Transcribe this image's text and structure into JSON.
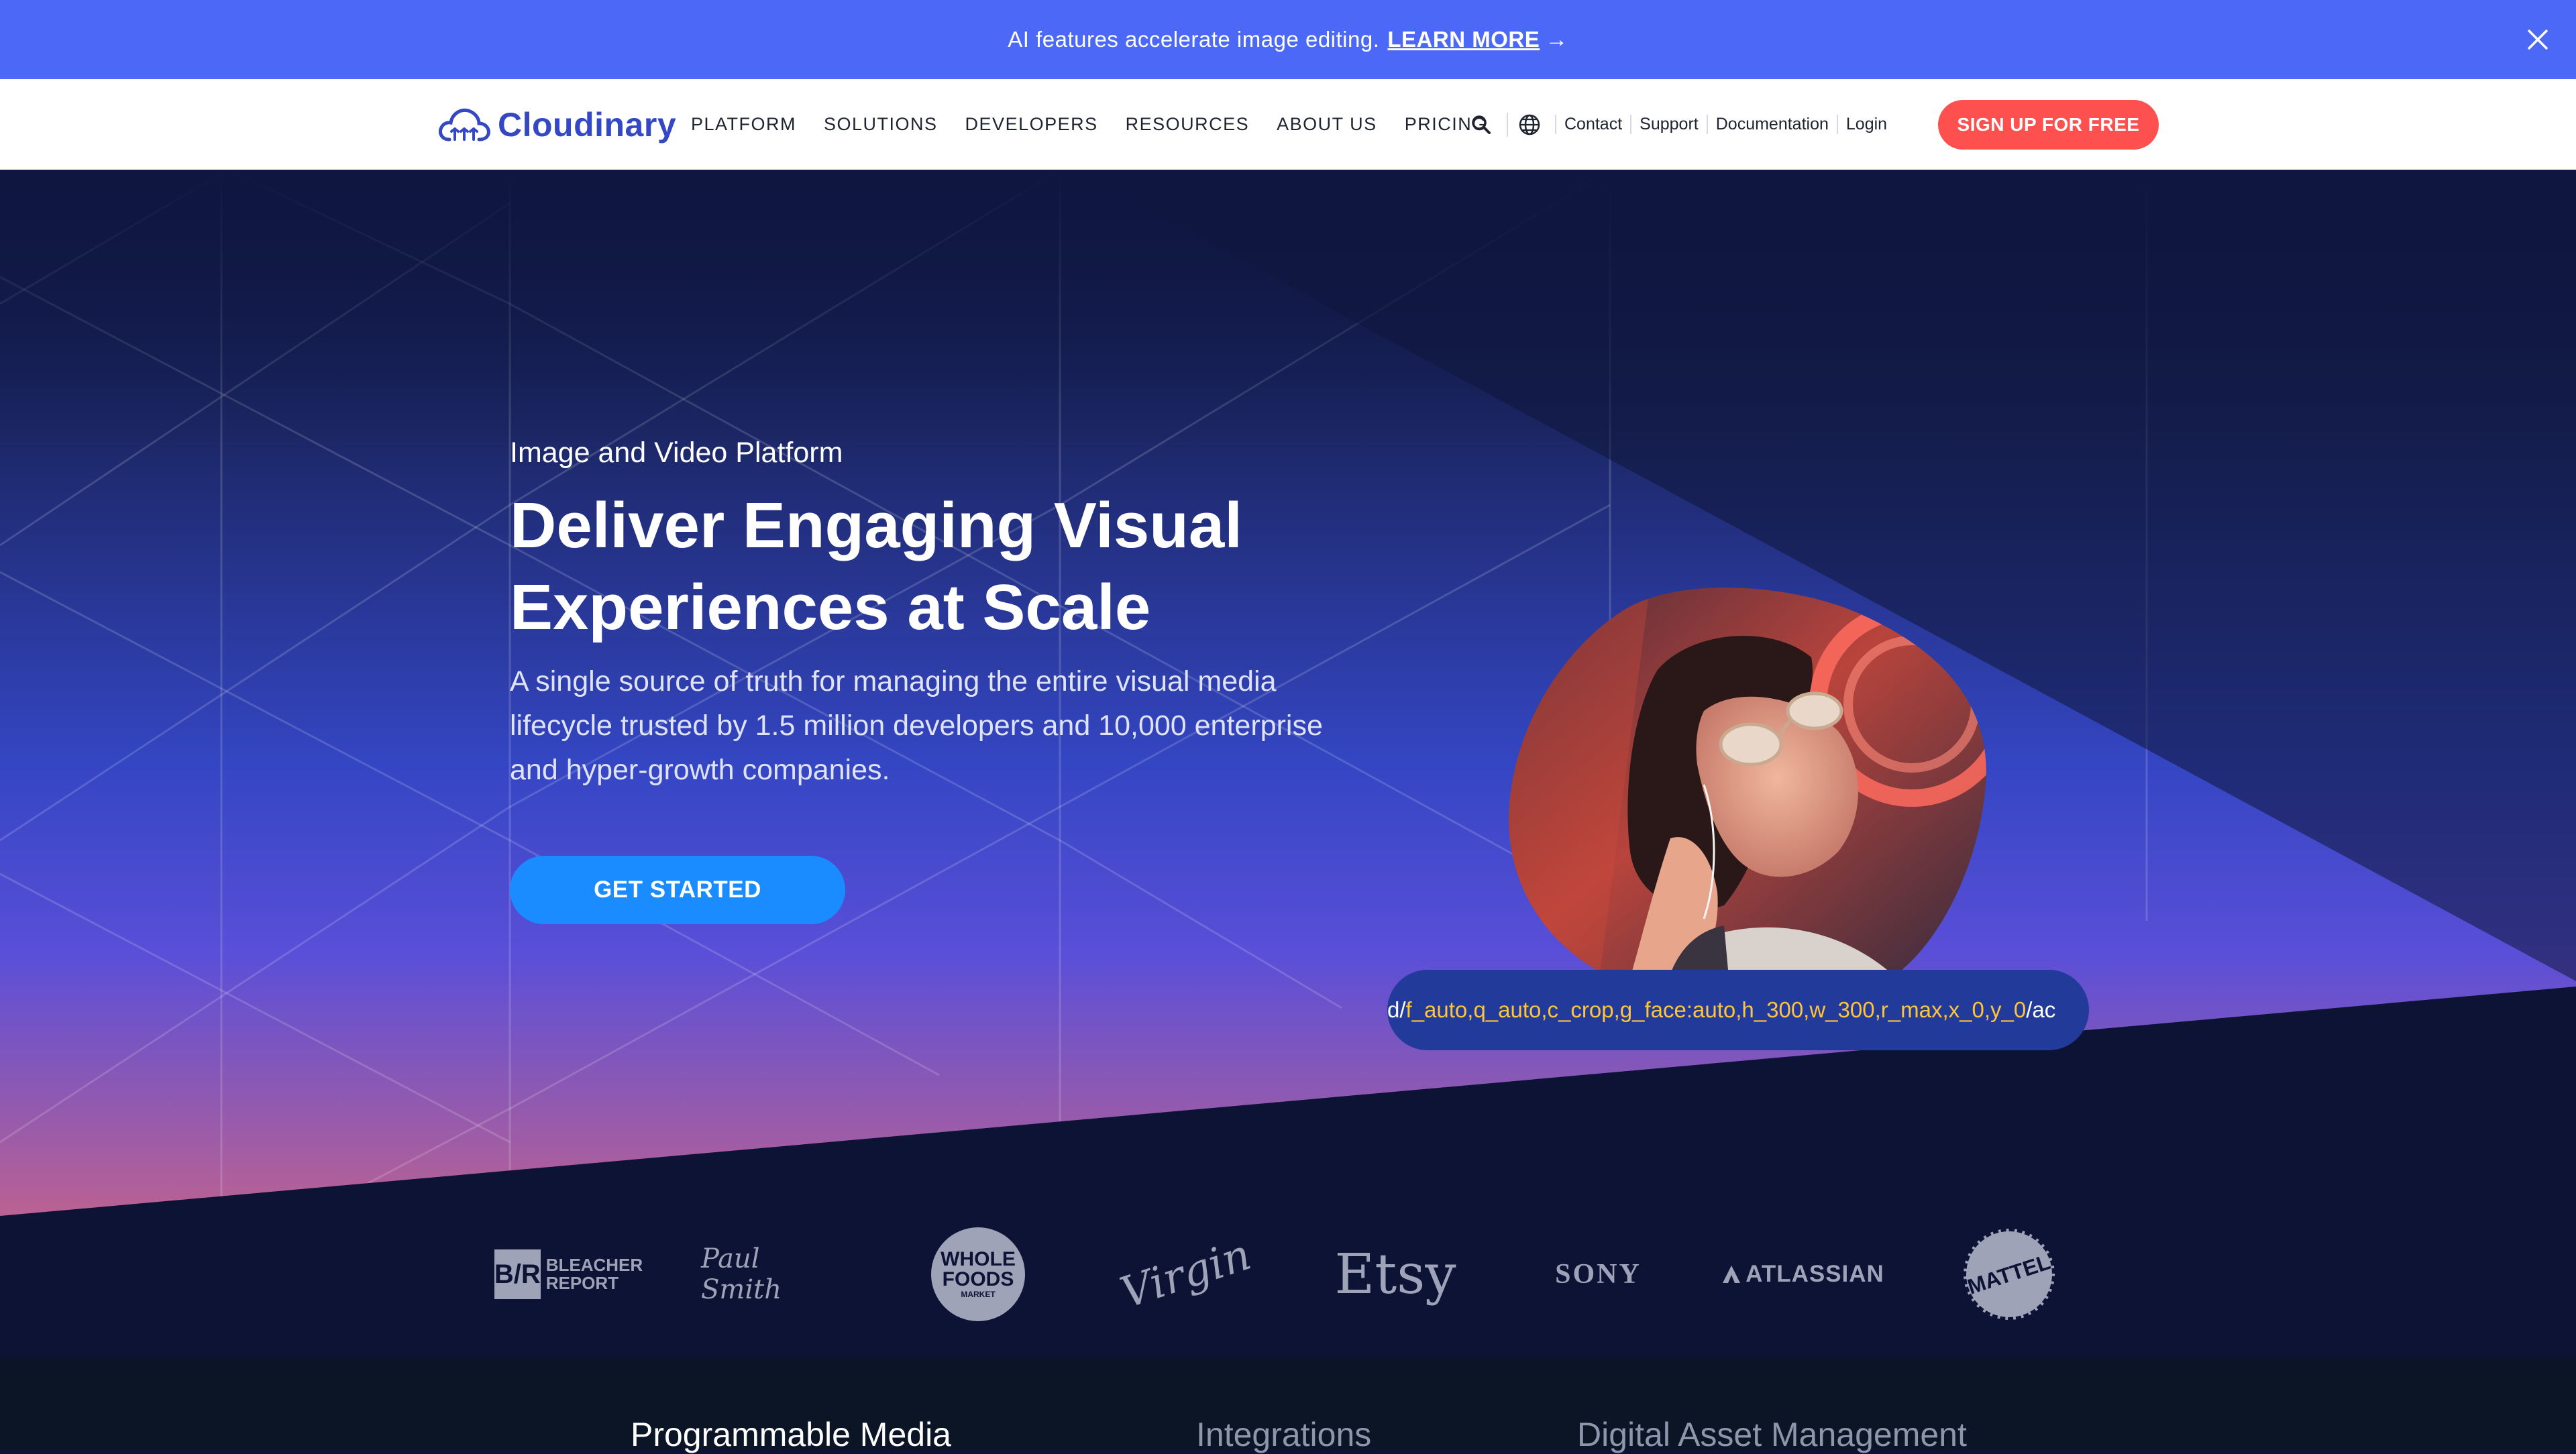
{
  "announcement": {
    "text": "AI features accelerate image editing.",
    "link_label": "LEARN MORE",
    "arrow": "→",
    "close_icon": "close-icon"
  },
  "nav": {
    "logo_text": "Cloudinary",
    "menu": [
      "PLATFORM",
      "SOLUTIONS",
      "DEVELOPERS",
      "RESOURCES",
      "ABOUT US",
      "PRICING"
    ],
    "icons": [
      "search-icon",
      "globe-icon"
    ],
    "utility_links": [
      "Contact",
      "Support",
      "Documentation",
      "Login"
    ],
    "signup_label": "SIGN UP FOR FREE"
  },
  "hero": {
    "eyebrow": "Image and Video Platform",
    "headline_line1": "Deliver Engaging Visual",
    "headline_line2": "Experiences at Scale",
    "subtext": "A single source of truth for managing the entire visual media lifecycle trusted by 1.5 million developers and 10,000 enterprise and hyper-growth companies.",
    "cta_label": "GET STARTED",
    "url_prefix": "d/",
    "url_params": "f_auto,q_auto,c_crop,g_face:auto,h_300,w_300,r_max,x_0,y_0",
    "url_suffix": "/ac"
  },
  "logos": {
    "bleacher_mark": "B/R",
    "bleacher_line1": "BLEACHER",
    "bleacher_line2": "REPORT",
    "paul_smith": "Paul Smith",
    "whole_foods_line1": "WHOLE",
    "whole_foods_line2": "FOODS",
    "whole_foods_line3": "MARKET",
    "virgin": "Virgin",
    "etsy": "Etsy",
    "sony": "SONY",
    "atlassian": "ATLASSIAN",
    "mattel": "MATTEL"
  },
  "tabs": [
    "Programmable Media",
    "Integrations",
    "Digital Asset Management"
  ],
  "colors": {
    "announce_bg": "#4b68f6",
    "brand": "#3448c5",
    "signup": "#ff5050",
    "cta": "#1a8cff",
    "param_text": "#ffc43d"
  }
}
